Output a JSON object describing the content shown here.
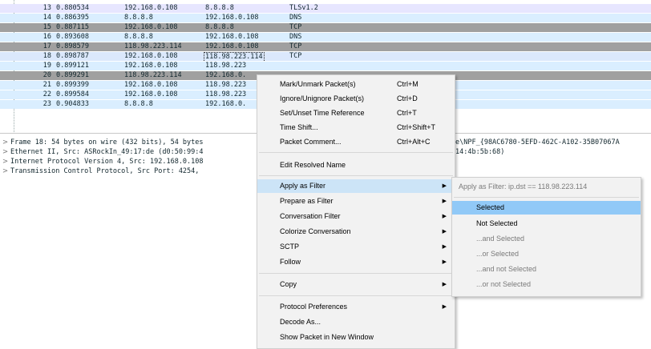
{
  "packets": [
    {
      "no": "13",
      "time": "0.880534",
      "src": "192.168.0.108",
      "dst": "8.8.8.8",
      "proto": "TLSv1.2",
      "kind": "tls"
    },
    {
      "no": "14",
      "time": "0.886395",
      "src": "8.8.8.8",
      "dst": "192.168.0.108",
      "proto": "DNS",
      "kind": "dns"
    },
    {
      "no": "15",
      "time": "0.887115",
      "src": "192.168.0.108",
      "dst": "8.8.8.8",
      "proto": "TCP",
      "kind": "tcp"
    },
    {
      "no": "16",
      "time": "0.893608",
      "src": "8.8.8.8",
      "dst": "192.168.0.108",
      "proto": "DNS",
      "kind": "dns"
    },
    {
      "no": "17",
      "time": "0.898579",
      "src": "118.98.223.114",
      "dst": "192.168.0.108",
      "proto": "TCP",
      "kind": "tcp"
    },
    {
      "no": "18",
      "time": "0.898787",
      "src": "192.168.0.108",
      "dst": "118.98.223.114",
      "proto": "TCP",
      "kind": "sel"
    },
    {
      "no": "19",
      "time": "0.899121",
      "src": "192.168.0.108",
      "dst": "118.98.223",
      "proto": "",
      "kind": "dns"
    },
    {
      "no": "20",
      "time": "0.899291",
      "src": "118.98.223.114",
      "dst": "192.168.0.",
      "proto": "",
      "kind": "tcp"
    },
    {
      "no": "21",
      "time": "0.899399",
      "src": "192.168.0.108",
      "dst": "118.98.223",
      "proto": "",
      "kind": "dns"
    },
    {
      "no": "22",
      "time": "0.899584",
      "src": "192.168.0.108",
      "dst": "118.98.223",
      "proto": "",
      "kind": "dns"
    },
    {
      "no": "23",
      "time": "0.904833",
      "src": "8.8.8.8",
      "dst": "192.168.0.",
      "proto": "",
      "kind": "dns"
    }
  ],
  "details": [
    {
      "left": "Frame 18: 54 bytes on wire (432 bits), 54 bytes",
      "right": "e\\NPF_{98AC6780-5EFD-462C-A102-35B07067A"
    },
    {
      "left": "Ethernet II, Src: ASRockIn_49:17:de (d0:50:99:4",
      "right": "14:4b:5b:68)"
    },
    {
      "left": "Internet Protocol Version 4, Src: 192.168.0.108",
      "right": ""
    },
    {
      "left": "Transmission Control Protocol, Src Port: 4254,",
      "right": ""
    }
  ],
  "context_menu": {
    "items": [
      {
        "label": "Mark/Unmark Packet(s)",
        "shortcut": "Ctrl+M"
      },
      {
        "label": "Ignore/Unignore Packet(s)",
        "shortcut": "Ctrl+D"
      },
      {
        "label": "Set/Unset Time Reference",
        "shortcut": "Ctrl+T"
      },
      {
        "label": "Time Shift...",
        "shortcut": "Ctrl+Shift+T"
      },
      {
        "label": "Packet Comment...",
        "shortcut": "Ctrl+Alt+C"
      },
      {
        "label": "Edit Resolved Name",
        "shortcut": ""
      },
      {
        "label": "Apply as Filter",
        "shortcut": ""
      },
      {
        "label": "Prepare as Filter",
        "shortcut": ""
      },
      {
        "label": "Conversation Filter",
        "shortcut": ""
      },
      {
        "label": "Colorize Conversation",
        "shortcut": ""
      },
      {
        "label": "SCTP",
        "shortcut": ""
      },
      {
        "label": "Follow",
        "shortcut": ""
      },
      {
        "label": "Copy",
        "shortcut": ""
      },
      {
        "label": "Protocol Preferences",
        "shortcut": ""
      },
      {
        "label": "Decode As...",
        "shortcut": ""
      },
      {
        "label": "Show Packet in New Window",
        "shortcut": ""
      }
    ]
  },
  "submenu": {
    "header": "Apply as Filter: ip.dst == 118.98.223.114",
    "items": [
      "Selected",
      "Not Selected",
      "...and Selected",
      "...or Selected",
      "...and not Selected",
      "...or not Selected"
    ]
  },
  "colors": {
    "tls_row": "#e7e6ff",
    "dns_row": "#daeeff",
    "tcp_row": "#a0a0a0",
    "selected_row": "#dbe8fc",
    "menu_highlight": "#cce4f7",
    "submenu_highlight": "#91c9f7"
  }
}
